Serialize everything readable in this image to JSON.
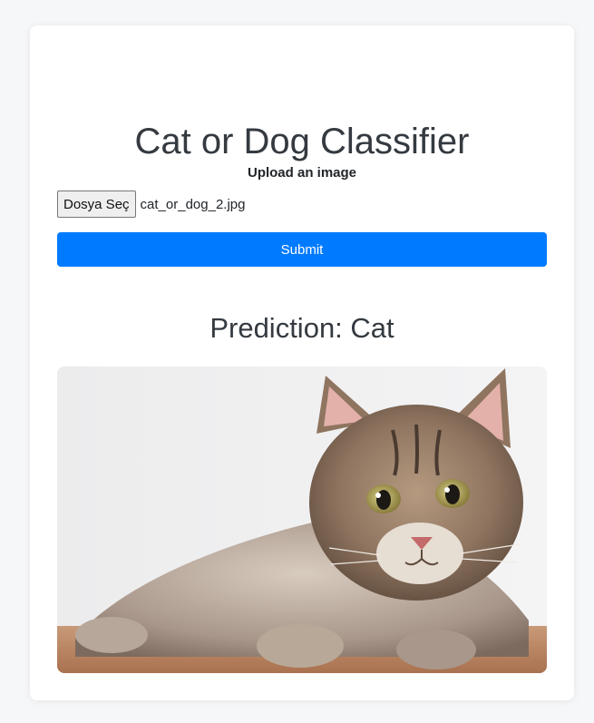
{
  "page": {
    "title": "Cat or Dog Classifier"
  },
  "upload": {
    "label": "Upload an image",
    "choose_button": "Dosya Seç",
    "file_name": "cat_or_dog_2.jpg"
  },
  "form": {
    "submit_label": "Submit"
  },
  "result": {
    "prediction_text": "Prediction: Cat"
  },
  "colors": {
    "primary": "#007bff",
    "card_bg": "#ffffff",
    "page_bg": "#f6f7f9",
    "heading": "#343a40"
  },
  "icons": {
    "uploaded_image": "cat-photo"
  }
}
